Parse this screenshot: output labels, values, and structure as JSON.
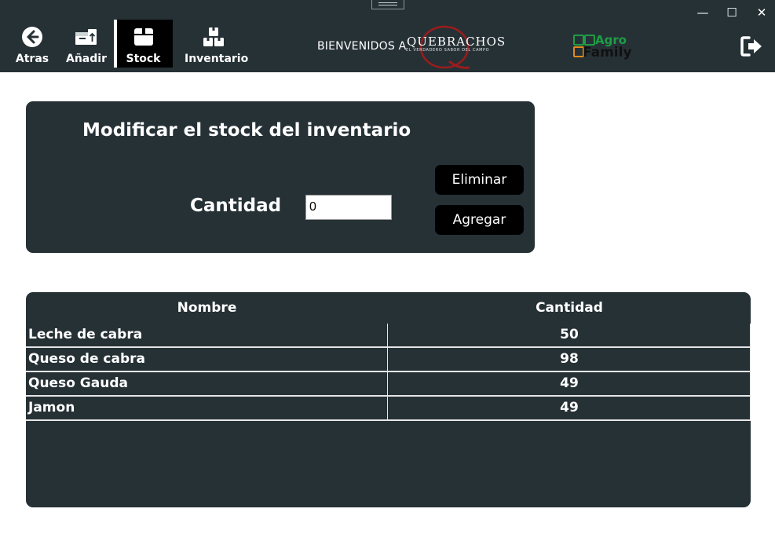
{
  "window": {
    "controls": {
      "minimize": "—",
      "maximize": "☐",
      "close": "✕"
    }
  },
  "nav": [
    {
      "label": "Atras",
      "icon": "back-arrow-icon"
    },
    {
      "label": "Añadir",
      "icon": "add-box-icon"
    },
    {
      "label": "Stock",
      "icon": "box-icon",
      "active": true
    },
    {
      "label": "Inventario",
      "icon": "stacked-boxes-icon"
    }
  ],
  "header": {
    "welcome": "BIENVENIDOS A",
    "logo_q": {
      "name": "QUEBRACHOS",
      "tagline": "EL VERDADERO SABOR DEL CAMPO"
    },
    "logo_agro": {
      "line1": "Agro",
      "line2": "Family"
    }
  },
  "panel": {
    "title": "Modificar el stock del inventario",
    "quantity_label": "Cantidad",
    "quantity_value": "0",
    "delete_label": "Eliminar",
    "add_label": "Agregar"
  },
  "table": {
    "headers": [
      "Nombre",
      "Cantidad"
    ],
    "rows": [
      {
        "name": "Leche de cabra",
        "qty": "50"
      },
      {
        "name": "Queso de cabra",
        "qty": "98"
      },
      {
        "name": "Queso Gauda",
        "qty": "49"
      },
      {
        "name": "Jamon",
        "qty": "49"
      }
    ]
  },
  "colors": {
    "bar": "#263136",
    "accent_red": "#9b1c1c",
    "agro_green": "#1e9c46",
    "agro_orange": "#e08a1e"
  }
}
